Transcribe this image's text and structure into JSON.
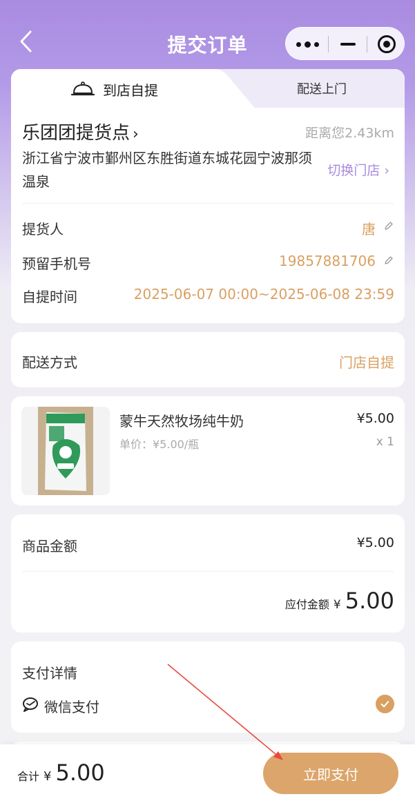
{
  "nav": {
    "title": "提交订单"
  },
  "tabs": {
    "pickup": "到店自提",
    "delivery": "配送上门"
  },
  "store": {
    "name": "乐团团提货点",
    "distance": "距离您2.43km",
    "address": "浙江省宁波市鄞州区东胜街道东城花园宁波那须温泉",
    "switch_label": "切换门店 ›"
  },
  "pickup_info": {
    "person_label": "提货人",
    "person_value": "唐",
    "phone_label": "预留手机号",
    "phone_value": "19857881706",
    "time_label": "自提时间",
    "time_value": "2025-06-07 00:00~2025-06-08 23:59"
  },
  "shipping": {
    "label": "配送方式",
    "value": "门店自提"
  },
  "product": {
    "name": "蒙牛天然牧场纯牛奶",
    "unit_price": "单价：¥5.00/瓶",
    "price": "¥5.00",
    "qty": "x 1"
  },
  "amount": {
    "goods_label": "商品金额",
    "goods_value": "¥5.00",
    "due_label": "应付金额",
    "due_currency": "¥",
    "due_value": "5.00"
  },
  "payment": {
    "title": "支付详情",
    "method": "微信支付"
  },
  "footer": {
    "total_label": "合计",
    "total_currency": "¥",
    "total_value": "5.00",
    "pay_button": "立即支付"
  },
  "colors": {
    "accent": "#d9a062",
    "purple": "#a98be0",
    "header": "#a98be0"
  },
  "icons": [
    "back-icon",
    "more-icon",
    "minimize-icon",
    "close-target-icon",
    "cloche-icon",
    "edit-icon",
    "wechat-pay-icon",
    "check-icon"
  ]
}
